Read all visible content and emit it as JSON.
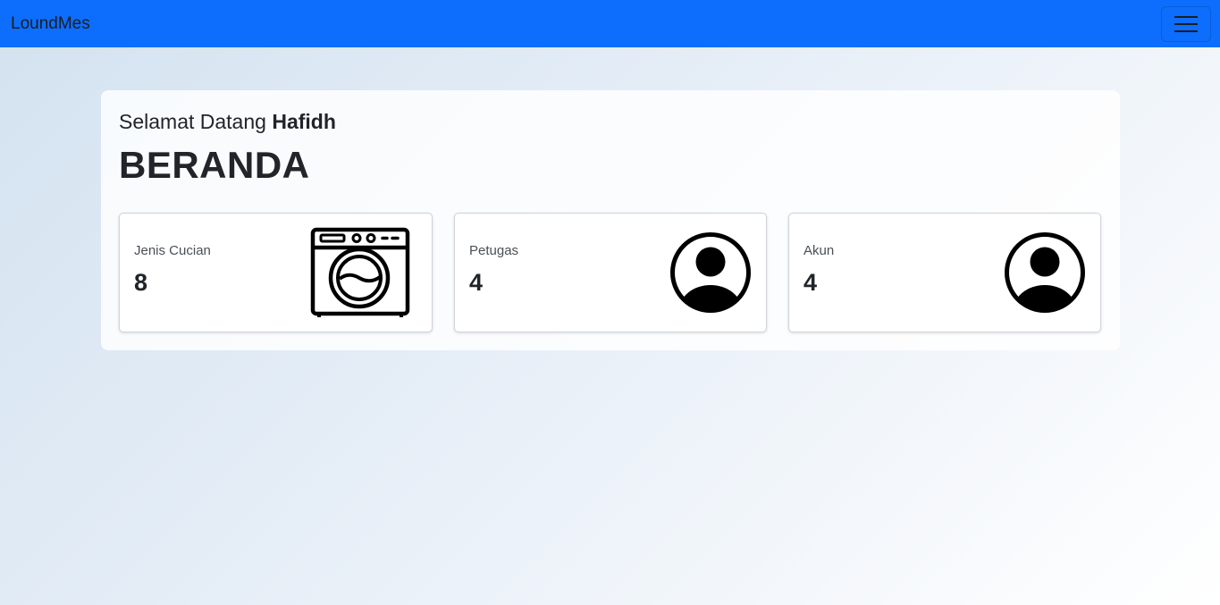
{
  "navbar": {
    "brand": "LoundMes",
    "toggler_icon": "hamburger-menu-icon",
    "color": "#0d6efd"
  },
  "main": {
    "welcome_prefix": "Selamat Datang",
    "welcome_name": "Hafidh",
    "title": "BERANDA"
  },
  "cards": [
    {
      "label": "Jenis Cucian",
      "value": "8",
      "icon": "washing-machine-icon"
    },
    {
      "label": "Petugas",
      "value": "4",
      "icon": "user-circle-icon"
    },
    {
      "label": "Akun",
      "value": "4",
      "icon": "user-circle-icon"
    }
  ]
}
